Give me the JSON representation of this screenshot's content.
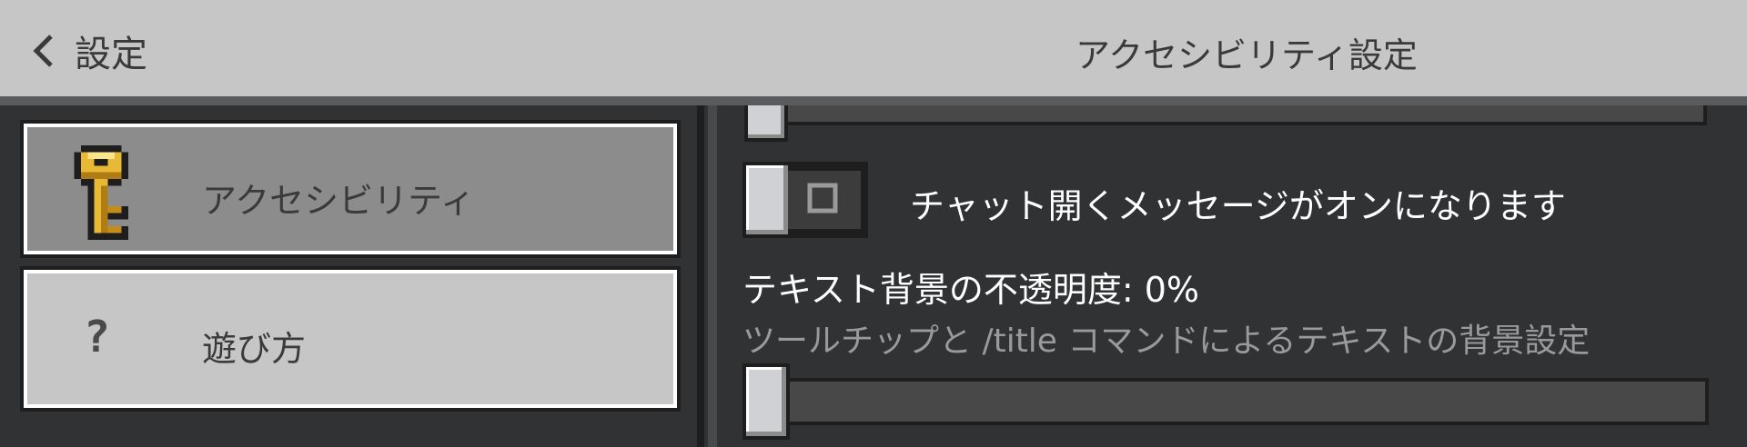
{
  "header": {
    "back_label": "設定",
    "title": "アクセシビリティ設定"
  },
  "sidebar": {
    "items": [
      {
        "label": "アクセシビリティ",
        "icon": "key-icon",
        "active": true
      },
      {
        "label": "遊び方",
        "icon": "question-mark-icon",
        "glyph": "?",
        "active": false
      }
    ]
  },
  "settings": {
    "chat_toggle": {
      "label": "チャット開くメッセージがオンになります",
      "state": "off"
    },
    "text_bg_opacity": {
      "label": "テキスト背景の不透明度: 0%",
      "description": "ツールチップと /title コマンドによるテキストの背景設定",
      "value": 0
    }
  },
  "colors": {
    "header_bg": "#c6c6c6",
    "panel_bg": "#313233",
    "active_item_bg": "#8c8c8c",
    "key_gold": "#e8b935"
  }
}
